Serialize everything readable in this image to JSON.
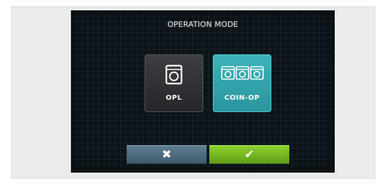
{
  "screen": {
    "title": "OPERATION MODE"
  },
  "modes": [
    {
      "label": "OPL",
      "icon": "washing-machine-icon",
      "selected": false
    },
    {
      "label": "COIN-OP",
      "icon": "coin-op-washers-icon",
      "selected": true
    }
  ],
  "actions": {
    "cancel_symbol": "✖",
    "confirm_symbol": "✔",
    "cancel_icon": "cross-icon",
    "confirm_icon": "check-icon"
  },
  "colors": {
    "selected_mode": "#2fa3aa",
    "unselected_mode": "#303134",
    "cancel_button": "#4d6b7d",
    "confirm_button": "#76b621",
    "screen_background": "#0c1419"
  }
}
